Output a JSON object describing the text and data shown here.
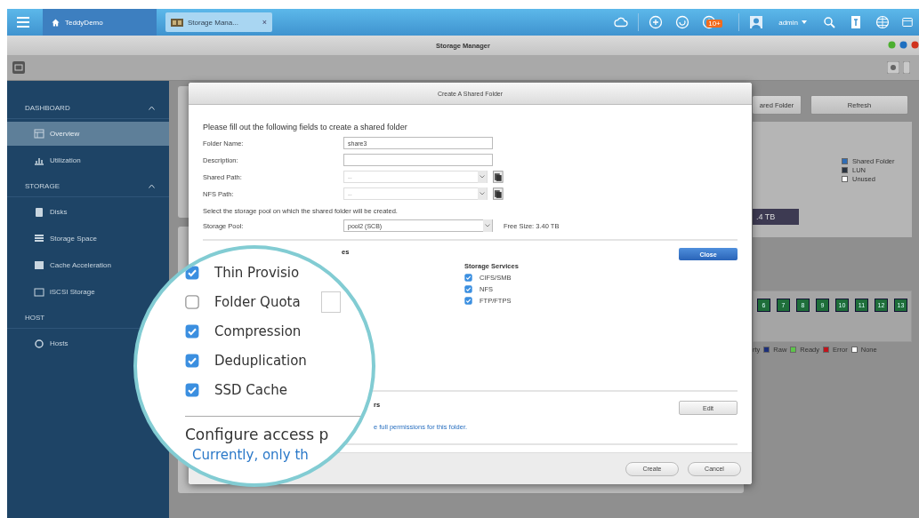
{
  "top_bar": {
    "home_tab": "TeddyDemo",
    "app_tab": "Storage Mana...",
    "close": "×",
    "badge": "10+",
    "user": "admin"
  },
  "window": {
    "title": "Storage Manager"
  },
  "sidebar": {
    "sections": [
      {
        "label": "DASHBOARD",
        "expanded": true,
        "items": [
          {
            "label": "Overview",
            "selected": true
          },
          {
            "label": "Utilization",
            "selected": false
          }
        ]
      },
      {
        "label": "STORAGE",
        "expanded": true,
        "items": [
          {
            "label": "Disks",
            "selected": false
          },
          {
            "label": "Storage Space",
            "selected": false
          },
          {
            "label": "Cache Acceleration",
            "selected": false
          },
          {
            "label": "iSCSI Storage",
            "selected": false
          }
        ]
      },
      {
        "label": "HOST",
        "items": [
          {
            "label": "Hosts",
            "selected": false
          }
        ]
      }
    ]
  },
  "background": {
    "buttons": [
      "ared Folder",
      "Refresh"
    ],
    "capacity": ".4 TB",
    "legend": [
      {
        "label": "Shared Folder",
        "color": "#2f6db5"
      },
      {
        "label": "LUN",
        "color": "#2b3440"
      },
      {
        "label": "Unused",
        "color": "#ffffff"
      }
    ],
    "disks": [
      "6",
      "7",
      "8",
      "9",
      "10",
      "11",
      "12",
      "13"
    ],
    "disk_legend": [
      {
        "label": "rty"
      },
      {
        "label": "Raw",
        "color": "#1c2f7a"
      },
      {
        "label": "Ready",
        "color": "#5dc44a"
      },
      {
        "label": "Error",
        "color": "#c0141c"
      },
      {
        "label": "None",
        "color": "#ffffff"
      }
    ]
  },
  "dialog": {
    "title": "Create A Shared Folder",
    "intro": "Please fill out the following fields to create a shared folder",
    "fields": [
      {
        "label": "Folder Name:",
        "kind": "text",
        "value": "share3"
      },
      {
        "label": "Description:",
        "kind": "text"
      },
      {
        "label": "Shared Path:",
        "kind": "select",
        "value": "--"
      },
      {
        "label": "NFS Path:",
        "kind": "select",
        "value": "--"
      }
    ],
    "pool_hint": "Select the storage pool on which the shared folder will be created.",
    "pool": {
      "label": "Storage Pool:",
      "value": "pool2 (SCB)",
      "free": "Free Size: 3.40 TB"
    },
    "section_heading": "es",
    "services": {
      "title": "Storage Services",
      "items": [
        {
          "label": "CIFS/SMB",
          "checked": true
        },
        {
          "label": "NFS",
          "checked": true
        },
        {
          "label": "FTP/FTPS",
          "checked": true
        }
      ]
    },
    "close_button": "Close",
    "permissions": {
      "heading": "rs",
      "note": "e full permissions for this folder.",
      "button": "Edit"
    },
    "footer_buttons": [
      "Create",
      "Cancel"
    ]
  },
  "magnifier": {
    "options": [
      {
        "label": "Thin Provisio",
        "checked": true,
        "kind": "plain"
      },
      {
        "label": "Folder Quota",
        "checked": false,
        "kind": "with-field"
      },
      {
        "label": "Compression",
        "checked": true,
        "kind": "plain"
      },
      {
        "label": "Deduplication",
        "checked": true,
        "kind": "plain"
      },
      {
        "label": "SSD Cache",
        "checked": true,
        "kind": "plain"
      }
    ],
    "heading": "Configure access p",
    "note": "Currently, only th"
  }
}
